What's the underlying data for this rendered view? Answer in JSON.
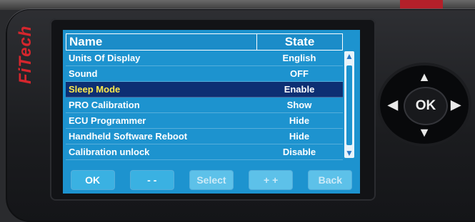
{
  "brand": "FiTech",
  "table": {
    "headers": {
      "name": "Name",
      "state": "State"
    },
    "rows": [
      {
        "name": "Units Of Display",
        "state": "English"
      },
      {
        "name": "Sound",
        "state": "OFF"
      },
      {
        "name": "Sleep Mode",
        "state": "Enable"
      },
      {
        "name": "PRO Calibration",
        "state": "Show"
      },
      {
        "name": "ECU Programmer",
        "state": "Hide"
      },
      {
        "name": "Handheld Software Reboot",
        "state": "Hide"
      },
      {
        "name": "Calibration unlock",
        "state": "Disable"
      }
    ],
    "selected_index": 2
  },
  "buttons": {
    "ok": "OK",
    "minus": "- -",
    "select": "Select",
    "plus": "+ +",
    "back": "Back"
  },
  "dpad": {
    "ok": "OK",
    "up": "▲",
    "down": "▼",
    "left": "◀",
    "right": "▶"
  },
  "scrollbar": {
    "up": "▲",
    "down": "▼"
  },
  "colors": {
    "screen": "#1d93cf",
    "selection": "#0d2f73",
    "selected_text": "#ffe94d",
    "brand": "#d5262d"
  }
}
